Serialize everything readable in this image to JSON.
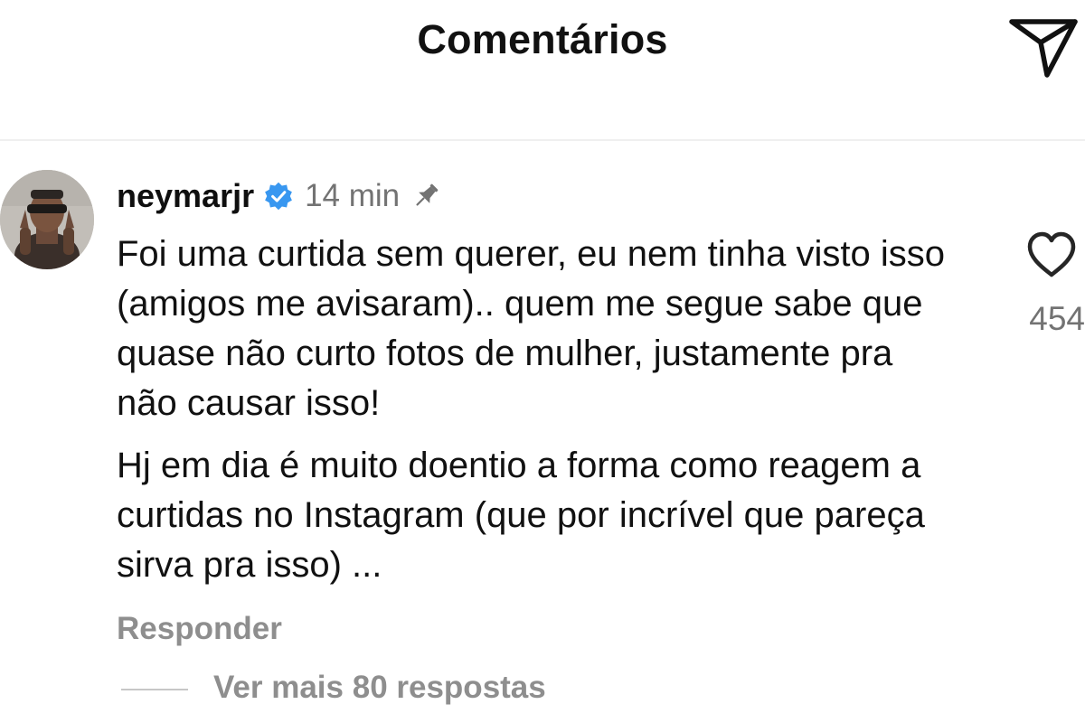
{
  "header": {
    "title": "Comentários",
    "share_icon": "send-icon"
  },
  "comment": {
    "avatar_icon": "avatar",
    "username": "neymarjr",
    "verified_icon": "verified-badge-icon",
    "verified_color": "#3897f0",
    "time": "14 min",
    "pinned_icon": "pin-icon",
    "paragraphs": [
      "Foi uma curtida sem querer, eu nem tinha visto isso (amigos me avisaram).. quem me segue sabe que quase não curto fotos de mulher, justamente pra não causar isso!",
      "Hj em dia é muito doentio a forma como reagem a curtidas no Instagram (que por incrível que pareça sirva pra isso) ..."
    ],
    "like_icon": "heart-icon",
    "like_count": "454",
    "reply_label": "Responder",
    "view_replies_label": "Ver mais 80 respostas"
  }
}
